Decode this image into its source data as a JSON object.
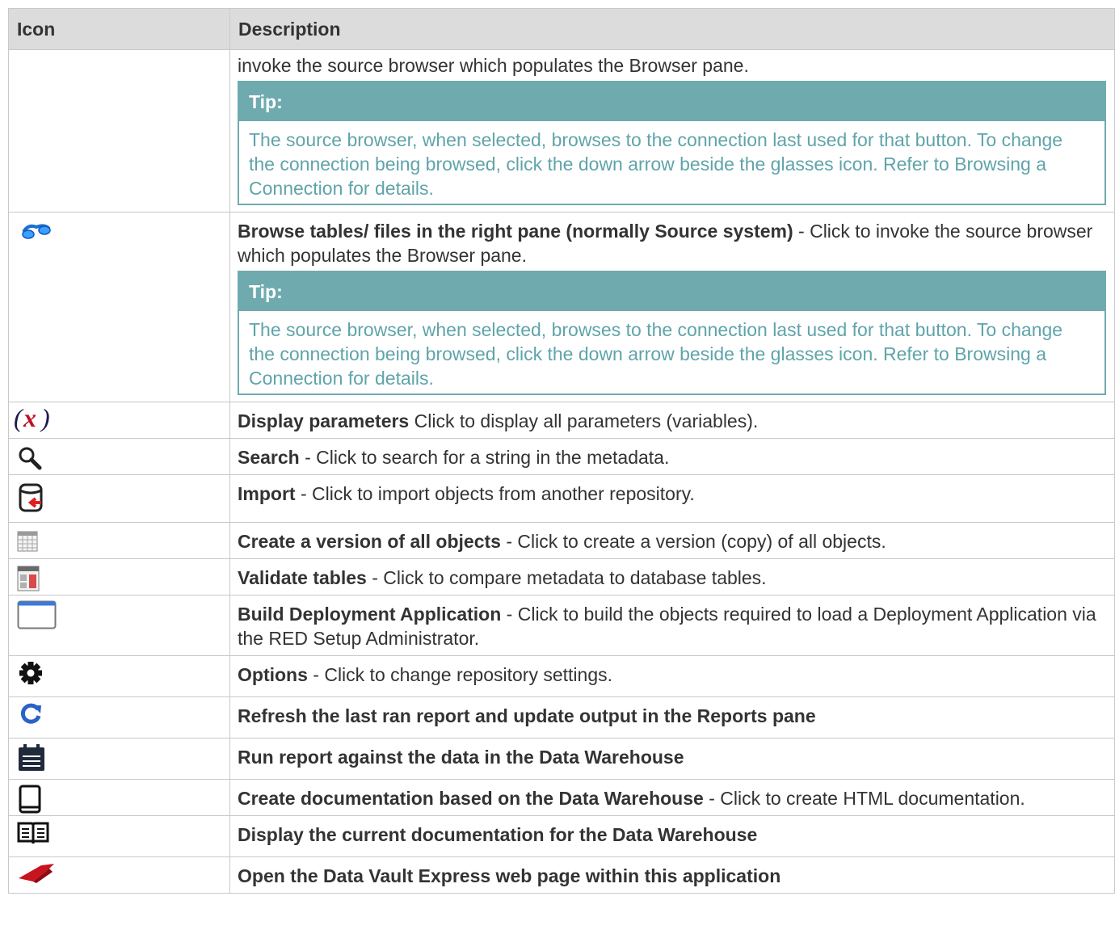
{
  "header": {
    "icon_col": "Icon",
    "desc_col": "Description"
  },
  "rows": [
    {
      "icon": "none",
      "bold": "",
      "text": "invoke the source browser which populates the Browser pane.",
      "tip": {
        "title": "Tip:",
        "body": " The source browser, when selected, browses to the connection last used for that button. To change the connection being browsed, click the down arrow beside the glasses icon. Refer to Browsing a Connection for details."
      }
    },
    {
      "icon": "glasses-icon",
      "bold": "Browse tables/ files in the right pane (normally Source system)",
      "text": " -  Click to invoke the source browser which populates the Browser pane.",
      "tip": {
        "title": "Tip:",
        "body": " The source browser, when selected, browses to the connection last used for that button. To change the connection being browsed, click the down arrow beside the glasses icon. Refer to Browsing a Connection for details."
      }
    },
    {
      "icon": "parameters-x-icon",
      "bold": "Display parameters",
      "text": " Click to display all parameters (variables)."
    },
    {
      "icon": "magnifier-icon",
      "bold": "Search",
      "text": " - Click to search for a string in the metadata."
    },
    {
      "icon": "database-import-icon",
      "bold": "Import",
      "text": " - Click to import objects from another repository."
    },
    {
      "icon": "grid-version-icon",
      "bold": "Create a version of all objects",
      "text": " - Click to create a version (copy) of all objects."
    },
    {
      "icon": "validate-tables-icon",
      "bold": "Validate tables",
      "text": " - Click to compare metadata to database tables."
    },
    {
      "icon": "window-icon",
      "bold": "Build Deployment Application",
      "text": " - Click to build the objects required to load a Deployment Application via the RED Setup Administrator."
    },
    {
      "icon": "gear-icon",
      "bold": "Options",
      "text": " - Click to change repository settings."
    },
    {
      "icon": "refresh-icon",
      "bold": "Refresh the last ran report and update output in the Reports pane",
      "text": ""
    },
    {
      "icon": "report-calendar-icon",
      "bold": "Run report against the data in the Data Warehouse",
      "text": ""
    },
    {
      "icon": "book-closed-icon",
      "bold": "Create documentation based on the Data Warehouse",
      "text": " - Click to create HTML documentation."
    },
    {
      "icon": "book-open-icon",
      "bold": "Display the current documentation for the Data Warehouse",
      "text": ""
    },
    {
      "icon": "dve-logo-icon",
      "bold": "Open the Data Vault Express web page within this application",
      "text": ""
    }
  ],
  "colors": {
    "header_bg": "#dcdcdc",
    "tip_accent": "#6faaaf",
    "tip_text": "#5fa4aa",
    "border": "#c8c8c8"
  }
}
